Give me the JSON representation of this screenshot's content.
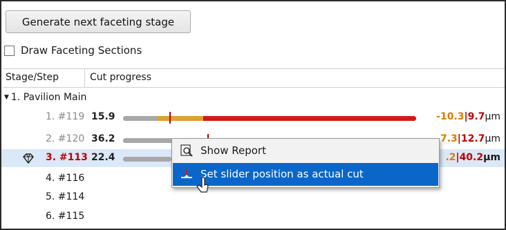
{
  "toolbar": {
    "generate_label": "Generate next faceting stage"
  },
  "options": {
    "draw_sections_label": "Draw Faceting Sections",
    "draw_sections_checked": false
  },
  "table": {
    "columns": [
      "Stage/Step",
      "Cut progress"
    ],
    "group_label": "1. Pavilion Main",
    "rows": [
      {
        "step": "1. #119",
        "value": "15.9",
        "delta": "-10.3",
        "remain": "9.7",
        "unit": "μm"
      },
      {
        "step": "2. #120",
        "value": "36.2",
        "delta": "-7.3",
        "remain": "12.7",
        "unit": "μm"
      },
      {
        "step": "3. #113",
        "value": "22.4",
        "delta_partial": ".2",
        "remain": "40.2",
        "unit": "μm",
        "selected": true
      },
      {
        "step": "4. #116"
      },
      {
        "step": "5. #114"
      },
      {
        "step": "6. #115"
      }
    ]
  },
  "context_menu": {
    "items": [
      {
        "label": "Show Report",
        "icon": "report-magnifier-icon"
      },
      {
        "label": "Set slider position as actual cut",
        "icon": "slider-cut-icon",
        "highlighted": true
      }
    ]
  },
  "colors": {
    "cut_done": "#a8a8a8",
    "cut_target": "#e0a030",
    "cut_remaining": "#d21a1a",
    "selection": "#dbe8f7",
    "menu_highlight": "#0a67c9"
  }
}
